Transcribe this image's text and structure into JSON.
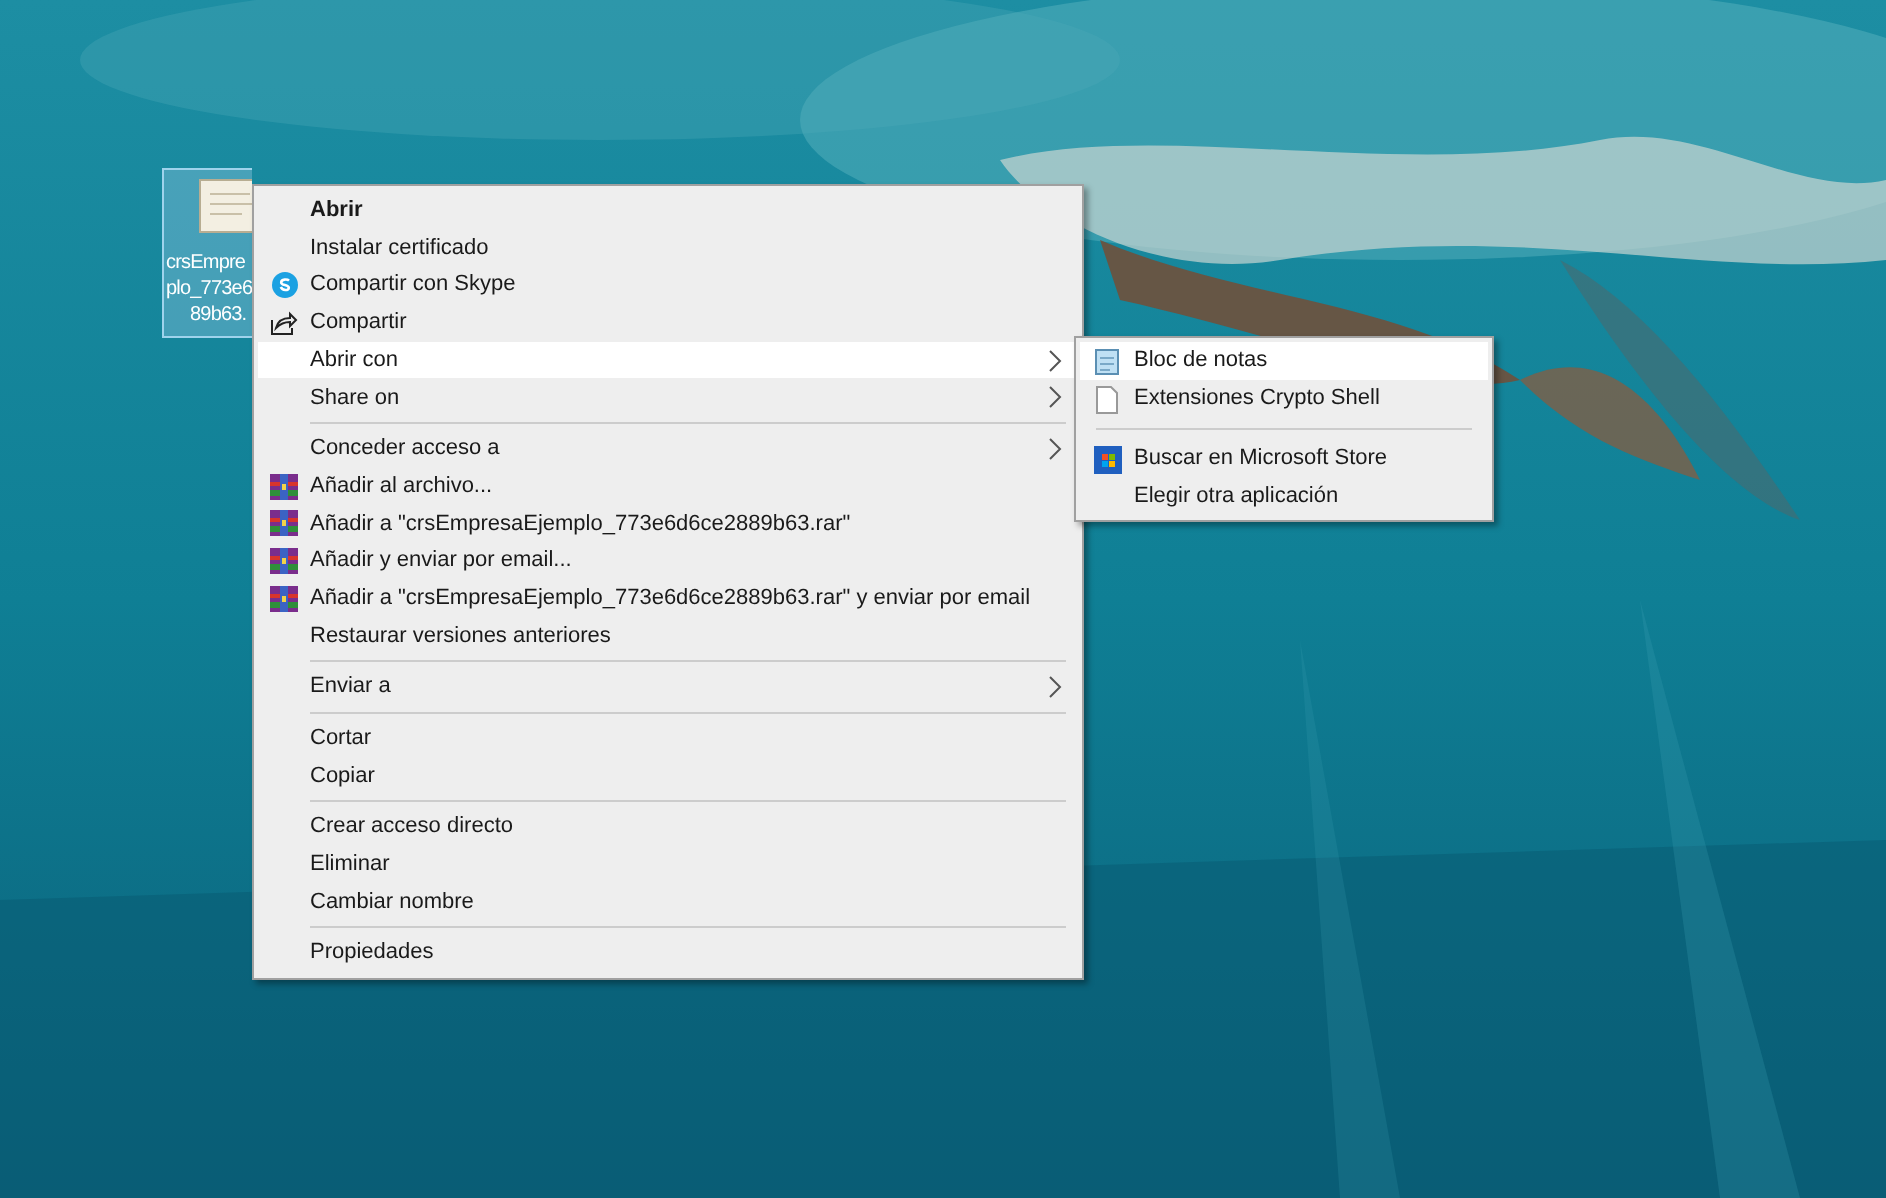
{
  "desktop_icon": {
    "label_lines": [
      "crsEmpre",
      "plo_773e6",
      "89b63."
    ],
    "selected": true
  },
  "context_menu": {
    "items": [
      {
        "kind": "plain",
        "label": "Abrir",
        "bold": true,
        "submenu": false,
        "selected": false
      },
      {
        "kind": "plain",
        "label": "Instalar certificado",
        "bold": false,
        "submenu": false,
        "selected": false
      },
      {
        "kind": "skype",
        "label": "Compartir con Skype",
        "bold": false,
        "submenu": false,
        "selected": false
      },
      {
        "kind": "share",
        "label": "Compartir",
        "bold": false,
        "submenu": false,
        "selected": false
      },
      {
        "kind": "plain",
        "label": "Abrir con",
        "bold": false,
        "submenu": true,
        "selected": true
      },
      {
        "kind": "plain",
        "label": "Share on",
        "bold": false,
        "submenu": true,
        "selected": false
      },
      {
        "kind": "separator"
      },
      {
        "kind": "plain",
        "label": "Conceder acceso a",
        "bold": false,
        "submenu": true,
        "selected": false
      },
      {
        "kind": "archive",
        "label": "Añadir al archivo...",
        "bold": false,
        "submenu": false,
        "selected": false
      },
      {
        "kind": "archive",
        "label": "Añadir a \"crsEmpresaEjemplo_773e6d6ce2889b63.rar\"",
        "bold": false,
        "submenu": false,
        "selected": false
      },
      {
        "kind": "archive",
        "label": "Añadir y enviar por email...",
        "bold": false,
        "submenu": false,
        "selected": false
      },
      {
        "kind": "archive",
        "label": "Añadir a \"crsEmpresaEjemplo_773e6d6ce2889b63.rar\" y enviar por email",
        "bold": false,
        "submenu": false,
        "selected": false
      },
      {
        "kind": "plain",
        "label": "Restaurar versiones anteriores",
        "bold": false,
        "submenu": false,
        "selected": false
      },
      {
        "kind": "separator"
      },
      {
        "kind": "plain",
        "label": "Enviar a",
        "bold": false,
        "submenu": true,
        "selected": false
      },
      {
        "kind": "separator"
      },
      {
        "kind": "plain",
        "label": "Cortar",
        "bold": false,
        "submenu": false,
        "selected": false
      },
      {
        "kind": "plain",
        "label": "Copiar",
        "bold": false,
        "submenu": false,
        "selected": false
      },
      {
        "kind": "separator"
      },
      {
        "kind": "plain",
        "label": "Crear acceso directo",
        "bold": false,
        "submenu": false,
        "selected": false
      },
      {
        "kind": "plain",
        "label": "Eliminar",
        "bold": false,
        "submenu": false,
        "selected": false
      },
      {
        "kind": "plain",
        "label": "Cambiar nombre",
        "bold": false,
        "submenu": false,
        "selected": false
      },
      {
        "kind": "separator"
      },
      {
        "kind": "plain",
        "label": "Propiedades",
        "bold": false,
        "submenu": false,
        "selected": false
      }
    ]
  },
  "open_with_submenu": {
    "items": [
      {
        "kind": "notepad",
        "label": "Bloc de notas",
        "selected": true
      },
      {
        "kind": "document",
        "label": "Extensiones Crypto Shell",
        "selected": false
      },
      {
        "kind": "separator"
      },
      {
        "kind": "store",
        "label": "Buscar en Microsoft Store",
        "selected": false
      },
      {
        "kind": "plain",
        "label": "Elegir otra aplicación",
        "selected": false
      }
    ]
  }
}
